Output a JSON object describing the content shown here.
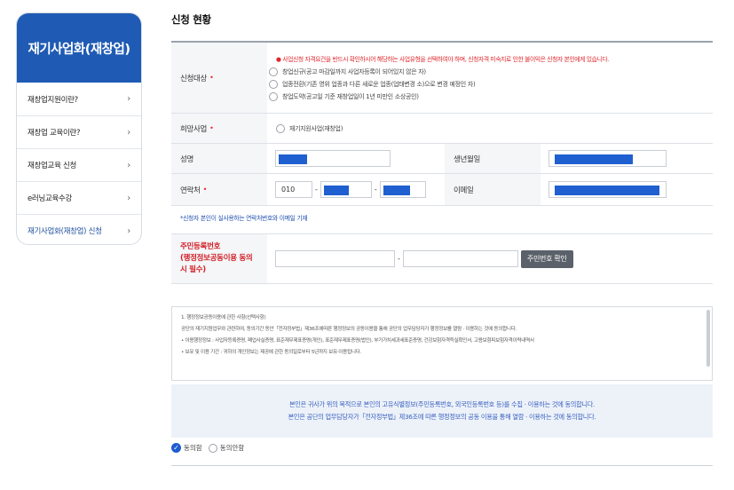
{
  "sidebar": {
    "title": "재기사업화(재창업)",
    "items": [
      {
        "label": "재창업지원이란?"
      },
      {
        "label": "재창업 교육이란?"
      },
      {
        "label": "재창업교육 신청"
      },
      {
        "label": "e러닝교육수강"
      },
      {
        "label": "재기사업화(재창업) 신청"
      }
    ]
  },
  "main": {
    "title": "신청 현황",
    "target": {
      "label": "신청대상",
      "warning": "● 사업신청 자격요건을 반드시 확인하시어 해당하는 사업유형을 선택하여야 하며, 신청자격 미숙지로 인한 불이익은 신청자 본인에게 있습니다.",
      "options": [
        "창업신규(공고 마감일까지 사업자등록이 되어있지 않은 자)",
        "업종전환(기존 영위 업종과 다른 새로운 업종(업태변경 소)으로 변경 예정인 자)",
        "창업도약(공고일 기준 재창업일이 1년 미만인 소상공인)"
      ]
    },
    "business": {
      "label": "희망사업",
      "option": "재기지원사업(재창업)"
    },
    "name": {
      "label": "성명"
    },
    "birth": {
      "label": "생년월일"
    },
    "phone": {
      "label": "연락처",
      "prefix": "010",
      "dash": "-"
    },
    "email": {
      "label": "이메일"
    },
    "note": "*신청자 본인이 실사용하는 연락처번호와 이메일 기재",
    "rrn": {
      "label_line1": "주민등록번호",
      "label_line2": "(행정정보공동이용 동의",
      "label_line3": "시 필수)",
      "dash": "-",
      "button": "주민번호 확인"
    },
    "terms": {
      "heading": "1. 행정정보공동이용에 관한 사항(선택사항)",
      "line1": "공단의 재기지원업무와 관련하여, 동의기간 동안「전자정부법」제36조에따른 행정정보의 공동이용을 통해 공단의 업무담당자가 행정정보를 열람 · 이용하는 것에 동의합니다.",
      "line2": "• 이용행정정보 : 사업자등록증명, 폐업사실증명, 표준재무제표증명(개인), 표준재무제표증명(법인), 부가가치세과세표준증명, 건강보험자격득실확인서, 고용보험피보험자격이력내역서",
      "line3": "• 보유 및 이용 기간 : 귀하의 개인정보는 제공에 관한 동의일로부터 5년까지 보유·이용됩니다."
    },
    "consent": {
      "line1": "본인은 귀사가 위의 목적으로 본인의 고유식별정보(주민등록번호, 외국인등록번호 등)를 수집 · 이용하는 것에 동의합니다.",
      "line2": "본인은 공단의 업무담당자가「전자정부법」제36조에 따른 행정정보의 공동 이용을 통해 열람 · 이용하는 것에 동의합니다."
    },
    "agree": {
      "yes": "동의함",
      "no": "동의안함"
    }
  },
  "colors": {
    "primary": "#1f5bb4",
    "mask": "#1f5fd0",
    "warning": "#e0262c",
    "consent_bg": "#edf2f9"
  }
}
